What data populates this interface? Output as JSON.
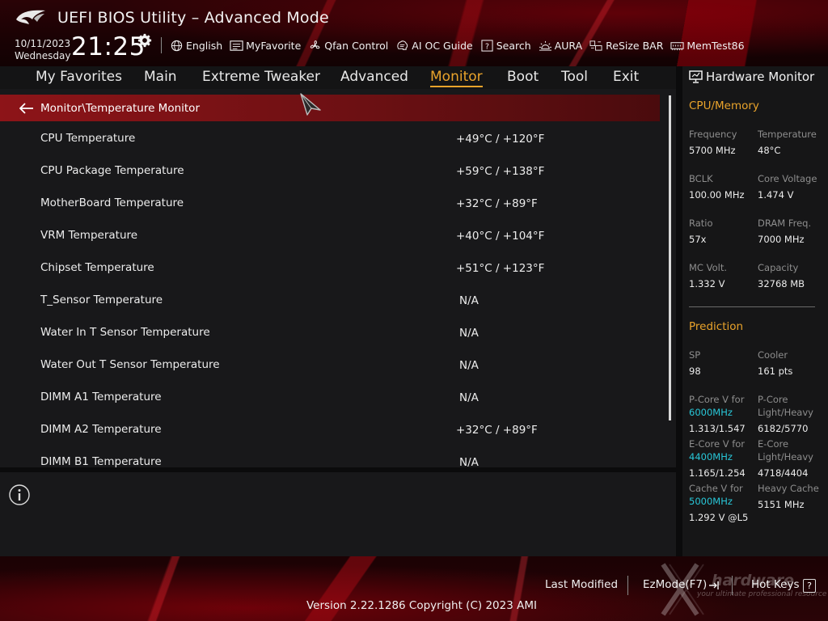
{
  "header": {
    "title": "UEFI BIOS Utility – Advanced Mode",
    "date": "10/11/2023",
    "weekday": "Wednesday",
    "time": "21:25"
  },
  "toolbar": [
    {
      "label": "English",
      "icon": "globe-icon"
    },
    {
      "label": "MyFavorite",
      "icon": "favorite-icon"
    },
    {
      "label": "Qfan Control",
      "icon": "fan-icon"
    },
    {
      "label": "AI OC Guide",
      "icon": "ai-icon"
    },
    {
      "label": "Search",
      "icon": "search-help-icon"
    },
    {
      "label": "AURA",
      "icon": "aura-icon"
    },
    {
      "label": "ReSize BAR",
      "icon": "resize-bar-icon"
    },
    {
      "label": "MemTest86",
      "icon": "memtest-icon"
    }
  ],
  "nav": {
    "items": [
      "My Favorites",
      "Main",
      "Extreme Tweaker",
      "Advanced",
      "Monitor",
      "Boot",
      "Tool",
      "Exit"
    ],
    "active": "Monitor"
  },
  "breadcrumb": "Monitor\\Temperature Monitor",
  "rows": [
    {
      "label": "CPU Temperature",
      "value": "+49°C / +120°F"
    },
    {
      "label": "CPU Package Temperature",
      "value": "+59°C / +138°F"
    },
    {
      "label": "MotherBoard Temperature",
      "value": "+32°C / +89°F"
    },
    {
      "label": "VRM Temperature",
      "value": "+40°C / +104°F"
    },
    {
      "label": "Chipset Temperature",
      "value": "+51°C / +123°F"
    },
    {
      "label": "T_Sensor Temperature",
      "value": "N/A"
    },
    {
      "label": "Water In T Sensor Temperature",
      "value": "N/A"
    },
    {
      "label": "Water Out T Sensor Temperature",
      "value": "N/A"
    },
    {
      "label": "DIMM A1 Temperature",
      "value": "N/A"
    },
    {
      "label": "DIMM A2 Temperature",
      "value": "+32°C / +89°F"
    },
    {
      "label": "DIMM B1 Temperature",
      "value": "N/A"
    }
  ],
  "hardware_monitor": {
    "title": "Hardware Monitor",
    "cpu_memory": {
      "title": "CPU/Memory",
      "frequency_label": "Frequency",
      "frequency": "5700 MHz",
      "temperature_label": "Temperature",
      "temperature": "48°C",
      "bclk_label": "BCLK",
      "bclk": "100.00 MHz",
      "core_voltage_label": "Core Voltage",
      "core_voltage": "1.474 V",
      "ratio_label": "Ratio",
      "ratio": "57x",
      "dram_freq_label": "DRAM Freq.",
      "dram_freq": "7000 MHz",
      "mc_volt_label": "MC Volt.",
      "mc_volt": "1.332 V",
      "capacity_label": "Capacity",
      "capacity": "32768 MB"
    },
    "prediction": {
      "title": "Prediction",
      "sp_label": "SP",
      "sp": "98",
      "cooler_label": "Cooler",
      "cooler": "161 pts",
      "pcore_v_label": "P-Core V for",
      "pcore_v_freq": "6000MHz",
      "pcore_v": "1.313/1.547",
      "pcore_lh_label_1": "P-Core",
      "pcore_lh_label_2": "Light/Heavy",
      "pcore_lh": "6182/5770",
      "ecore_v_label": "E-Core V for",
      "ecore_v_freq": "4400MHz",
      "ecore_v": "1.165/1.254",
      "ecore_lh_label_1": "E-Core",
      "ecore_lh_label_2": "Light/Heavy",
      "ecore_lh": "4718/4404",
      "cache_v_label": "Cache V for",
      "cache_v_freq": "5000MHz",
      "cache_v": "1.292 V @L5",
      "heavy_cache_label": "Heavy Cache",
      "heavy_cache": "5151 MHz"
    }
  },
  "footer": {
    "last_modified": "Last Modified",
    "ezmode": "EzMode(F7)",
    "hot_keys": "Hot Keys",
    "hot_keys_key": "?",
    "version": "Version 2.22.1286 Copyright (C) 2023 AMI"
  },
  "watermark": {
    "text": "hardware",
    "sub": "your ultimate professional resource"
  },
  "colors": {
    "accent": "#e9a32b",
    "highlight": "#28c7d8",
    "breadcrumb": "#8d1418"
  }
}
